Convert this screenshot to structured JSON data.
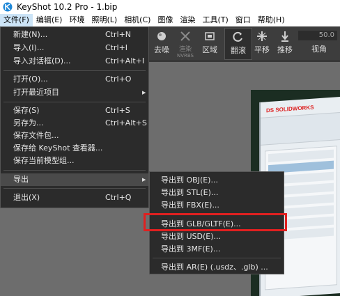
{
  "window": {
    "title": "KeyShot 10.2 Pro  -  1.bip"
  },
  "menubar": {
    "items": [
      "文件(F)",
      "编辑(E)",
      "环境",
      "照明(L)",
      "相机(C)",
      "图像",
      "渲染",
      "工具(T)",
      "窗口",
      "帮助(H)"
    ]
  },
  "toolbar": {
    "denoise": "去噪",
    "render_nvrbs": "渲染",
    "render_sub": "NVRBS",
    "region": "区域",
    "tumble": "翻滚",
    "pan": "平移",
    "dolly": "推移",
    "perspective": "视角",
    "fov_value": "50.0"
  },
  "file_menu": {
    "items": [
      {
        "label": "新建(N)...",
        "shortcut": "Ctrl+N"
      },
      {
        "label": "导入(I)...",
        "shortcut": "Ctrl+I"
      },
      {
        "label": "导入对话框(D)...",
        "shortcut": "Ctrl+Alt+I"
      },
      {
        "label": "打开(O)...",
        "shortcut": "Ctrl+O"
      },
      {
        "label": "打开最近项目",
        "shortcut": ""
      },
      {
        "label": "保存(S)",
        "shortcut": "Ctrl+S"
      },
      {
        "label": "另存为...",
        "shortcut": "Ctrl+Alt+S"
      },
      {
        "label": "保存文件包...",
        "shortcut": ""
      },
      {
        "label": "保存给 KeyShot 查看器...",
        "shortcut": ""
      },
      {
        "label": "保存当前模型组...",
        "shortcut": ""
      },
      {
        "label": "导出",
        "shortcut": ""
      },
      {
        "label": "退出(X)",
        "shortcut": "Ctrl+Q"
      }
    ]
  },
  "export_menu": {
    "items": [
      "导出到 OBJ(E)...",
      "导出到 STL(E)...",
      "导出到 FBX(E)...",
      "导出到 GLB/GLTF(E)...",
      "导出到 USD(E)...",
      "导出到 3MF(E)...",
      "导出到 AR(E)  (.usdz、.glb)  ..."
    ],
    "highlighted_index": 3,
    "highlight_color": "#e02020"
  },
  "viewport": {
    "logo_text": "DS SOLIDWORKS"
  }
}
